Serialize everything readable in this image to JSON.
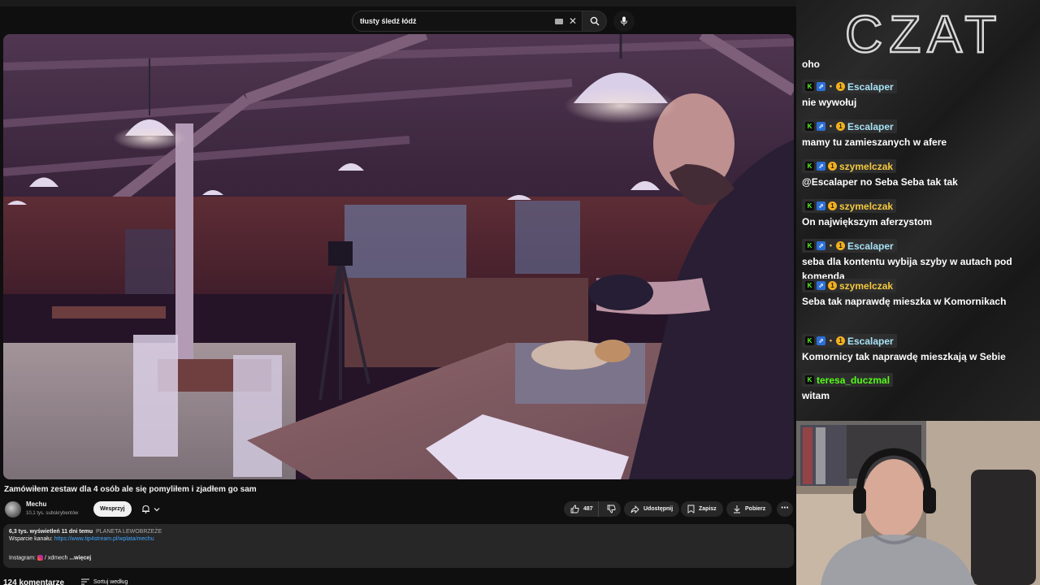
{
  "search": {
    "query": "tłusty śledź łódź"
  },
  "video": {
    "title": "Zamówiłem zestaw dla 4 osób ale się pomyliłem i zjadłem go sam",
    "channel_name": "Mechu",
    "subscribers": "10,1 tys. subskrybentów",
    "support_label": "Wesprzyj",
    "likes": "487",
    "share_label": "Udostępnij",
    "save_label": "Zapisz",
    "download_label": "Pobierz",
    "more_label": "⋯"
  },
  "description": {
    "meta": "6,3 tys. wyświetleń  11 dni temu",
    "hashtag": "PLANETA LEWOBRZEŻE",
    "support_label": "Wsparcie kanału:",
    "support_link": "https://www.tip4stream.pl/wplata/mechu",
    "instagram_label": "Instagram:",
    "instagram_handle": "/ xdmech",
    "more_label": "...więcej"
  },
  "comments": {
    "count_label": "124 komentarze",
    "sort_label": "Sortuj według"
  },
  "chat": {
    "header": "CZAT",
    "first_message": "oho",
    "messages": [
      {
        "user": "Escalaper",
        "color": "#a7e2f5",
        "badges": [
          "k",
          "prime",
          "bulb",
          "num"
        ],
        "text": "nie wywołuj"
      },
      {
        "user": "Escalaper",
        "color": "#a7e2f5",
        "badges": [
          "k",
          "prime",
          "bulb",
          "num"
        ],
        "text": "mamy tu zamieszanych w afere"
      },
      {
        "user": "szymelczak",
        "color": "#f5c93d",
        "badges": [
          "k",
          "prime",
          "num"
        ],
        "text": "@Escalaper no Seba Seba tak tak"
      },
      {
        "user": "szymelczak",
        "color": "#f5c93d",
        "badges": [
          "k",
          "prime",
          "num"
        ],
        "text": "On największym aferzystom"
      },
      {
        "user": "Escalaper",
        "color": "#a7e2f5",
        "badges": [
          "k",
          "prime",
          "bulb",
          "num"
        ],
        "text": "seba dla kontentu wybija szyby w autach pod komenda"
      },
      {
        "user": "szymelczak",
        "color": "#f5c93d",
        "badges": [
          "k",
          "prime",
          "num"
        ],
        "text": "Seba tak naprawdę mieszka w Komornikach"
      },
      {
        "user": "Escalaper",
        "color": "#a7e2f5",
        "badges": [
          "k",
          "prime",
          "bulb",
          "num"
        ],
        "text": "Komornicy tak naprawdę mieszkają w Sebie"
      },
      {
        "user": "teresa_duczmal",
        "color": "#53fc18",
        "badges": [
          "k"
        ],
        "text": "witam"
      }
    ]
  },
  "icons": {
    "keyboard": "keyboard-icon",
    "clear": "✕",
    "search": "search-icon",
    "mic": "mic-icon",
    "bell": "bell-icon",
    "like": "thumb-up-icon",
    "dislike": "thumb-down-icon",
    "share": "share-icon",
    "save": "bookmark-icon",
    "download": "download-icon",
    "sort": "sort-icon",
    "badge_k": "K",
    "badge_num": "1",
    "badge_bulb": "💡"
  },
  "colors": {
    "yt_bg": "#0f0f0f",
    "link": "#3ea6ff",
    "kick_green": "#53fc18"
  }
}
